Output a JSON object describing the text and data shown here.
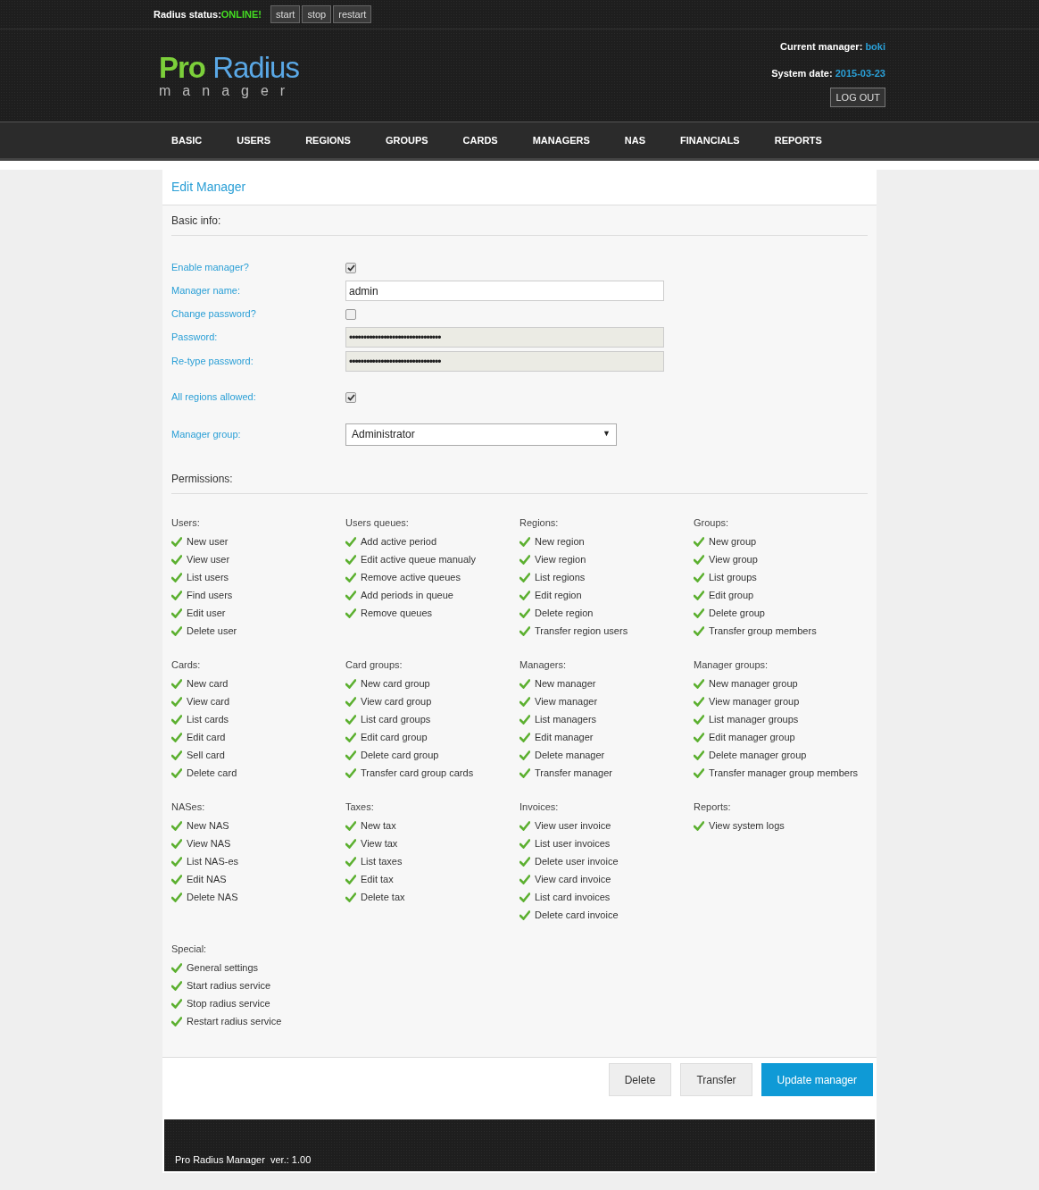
{
  "top_bar": {
    "status_label": "Radius status:",
    "status_value": "ONLINE!",
    "buttons": [
      "start",
      "stop",
      "restart"
    ]
  },
  "header": {
    "logo": {
      "pro": "Pro",
      "radius": "Radius",
      "sub": "manager"
    },
    "current_manager_label": "Current manager:",
    "current_manager": "boki",
    "system_date_label": "System date:",
    "system_date": "2015-03-23",
    "logout": "LOG OUT"
  },
  "nav": [
    "BASIC",
    "USERS",
    "REGIONS",
    "GROUPS",
    "CARDS",
    "MANAGERS",
    "NAS",
    "FINANCIALS",
    "REPORTS"
  ],
  "panel": {
    "title": "Edit Manager",
    "basic_heading": "Basic info:",
    "fields": [
      {
        "kind": "checkbox",
        "label": "Enable manager?",
        "checked": true
      },
      {
        "kind": "text",
        "label": "Manager name:",
        "value": "admin",
        "disabled": false
      },
      {
        "kind": "checkbox",
        "label": "Change password?",
        "checked": false
      },
      {
        "kind": "text",
        "label": "Password:",
        "value": "••••••••••••••••••••••••••••••••",
        "disabled": true
      },
      {
        "kind": "text",
        "label": "Re-type password:",
        "value": "••••••••••••••••••••••••••••••••",
        "disabled": true
      },
      {
        "kind": "checkbox",
        "label": "All regions allowed:",
        "checked": true
      },
      {
        "kind": "select",
        "label": "Manager group:",
        "value": "Administrator",
        "caret": "▼"
      }
    ],
    "permissions_heading": "Permissions:",
    "permission_groups": [
      {
        "title": "Users:",
        "items": [
          "New user",
          "View user",
          "List users",
          "Find users",
          "Edit user",
          "Delete user"
        ]
      },
      {
        "title": "Users queues:",
        "items": [
          "Add active period",
          "Edit active queue manualy",
          "Remove active queues",
          "Add periods in queue",
          "Remove queues"
        ]
      },
      {
        "title": "Regions:",
        "items": [
          "New region",
          "View region",
          "List regions",
          "Edit region",
          "Delete region",
          "Transfer region users"
        ]
      },
      {
        "title": "Groups:",
        "items": [
          "New group",
          "View group",
          "List groups",
          "Edit group",
          "Delete group",
          "Transfer group members"
        ]
      },
      {
        "title": "Cards:",
        "items": [
          "New card",
          "View card",
          "List cards",
          "Edit card",
          "Sell card",
          "Delete card"
        ]
      },
      {
        "title": "Card groups:",
        "items": [
          "New card group",
          "View card group",
          "List card groups",
          "Edit card group",
          "Delete card group",
          "Transfer card group cards"
        ]
      },
      {
        "title": "Managers:",
        "items": [
          "New manager",
          "View manager",
          "List managers",
          "Edit manager",
          "Delete manager",
          "Transfer manager"
        ]
      },
      {
        "title": "Manager groups:",
        "items": [
          "New manager group",
          "View manager group",
          "List manager groups",
          "Edit manager group",
          "Delete manager group",
          "Transfer manager group members"
        ]
      },
      {
        "title": "NASes:",
        "items": [
          "New NAS",
          "View NAS",
          "List NAS-es",
          "Edit NAS",
          "Delete NAS"
        ]
      },
      {
        "title": "Taxes:",
        "items": [
          "New tax",
          "View tax",
          "List taxes",
          "Edit tax",
          "Delete tax"
        ]
      },
      {
        "title": "Invoices:",
        "items": [
          "View user invoice",
          "List user invoices",
          "Delete user invoice",
          "View card invoice",
          "List card invoices",
          "Delete card invoice"
        ]
      },
      {
        "title": "Reports:",
        "items": [
          "View system logs"
        ]
      },
      {
        "title": "Special:",
        "items": [
          "General settings",
          "Start radius service",
          "Stop radius service",
          "Restart radius service"
        ]
      }
    ],
    "buttons": [
      {
        "label": "Delete",
        "kind": "secondary"
      },
      {
        "label": "Transfer",
        "kind": "secondary"
      },
      {
        "label": "Update manager",
        "kind": "primary"
      }
    ]
  },
  "footer": {
    "text": "Pro Radius Manager  ver.: 1.00"
  }
}
